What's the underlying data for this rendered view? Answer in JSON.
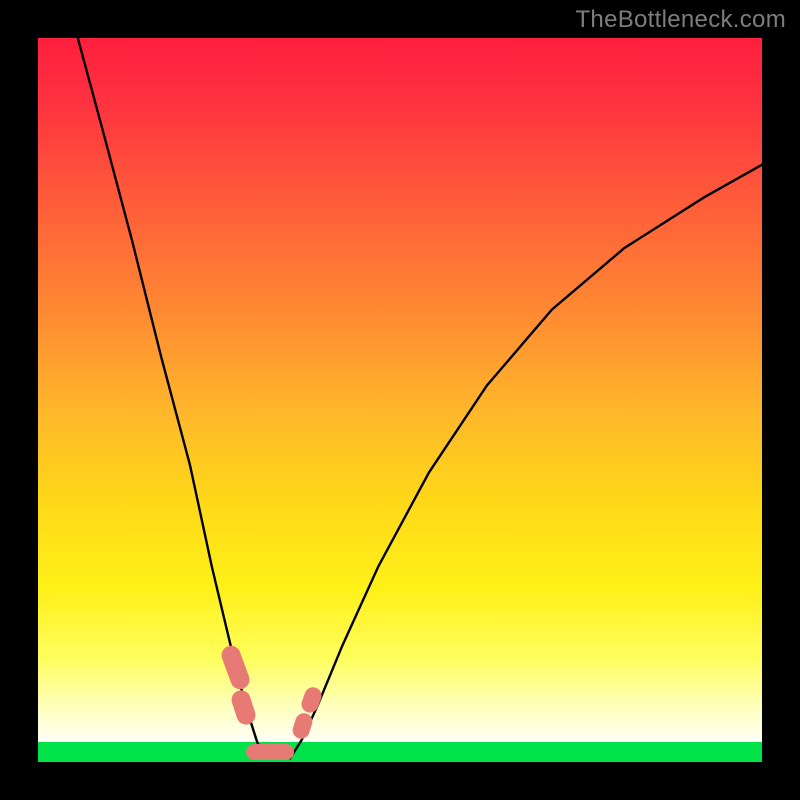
{
  "watermark": "TheBottleneck.com",
  "chart_data": {
    "type": "line",
    "title": "",
    "xlabel": "",
    "ylabel": "",
    "xlim": [
      0,
      100
    ],
    "ylim": [
      0,
      100
    ],
    "background_gradient": {
      "top": "#ff1f3e",
      "mid": "#ffd818",
      "bottom_band": "#00e24a"
    },
    "series": [
      {
        "name": "left-leg",
        "x": [
          5.5,
          9,
          13,
          17,
          21,
          24,
          26.5,
          28.6,
          30.2,
          31.2
        ],
        "values": [
          100,
          87,
          72,
          56,
          41,
          27,
          16.5,
          8,
          3,
          0.5
        ]
      },
      {
        "name": "right-leg",
        "x": [
          34.8,
          36.4,
          38.5,
          42,
          47,
          54,
          62,
          71,
          81,
          92,
          100
        ],
        "values": [
          0.5,
          3,
          7.5,
          16,
          27,
          40,
          52,
          62.5,
          71,
          78,
          82.5
        ]
      }
    ],
    "markers": [
      {
        "name": "left-upper-blob",
        "x": 27.2,
        "y": 13,
        "w": 2.6,
        "h": 6.2,
        "angle": -20
      },
      {
        "name": "left-lower-blob",
        "x": 28.4,
        "y": 7.5,
        "w": 2.6,
        "h": 4.8,
        "angle": -18
      },
      {
        "name": "valley-blob",
        "x": 32.0,
        "y": 1.4,
        "w": 6.6,
        "h": 2.2,
        "angle": 0
      },
      {
        "name": "right-lower-blob",
        "x": 36.5,
        "y": 5.0,
        "w": 2.4,
        "h": 3.6,
        "angle": 18
      },
      {
        "name": "right-upper-blob",
        "x": 37.8,
        "y": 8.5,
        "w": 2.4,
        "h": 3.6,
        "angle": 20
      }
    ],
    "colors": {
      "curve": "#000000",
      "marker": "#e77a74"
    }
  }
}
